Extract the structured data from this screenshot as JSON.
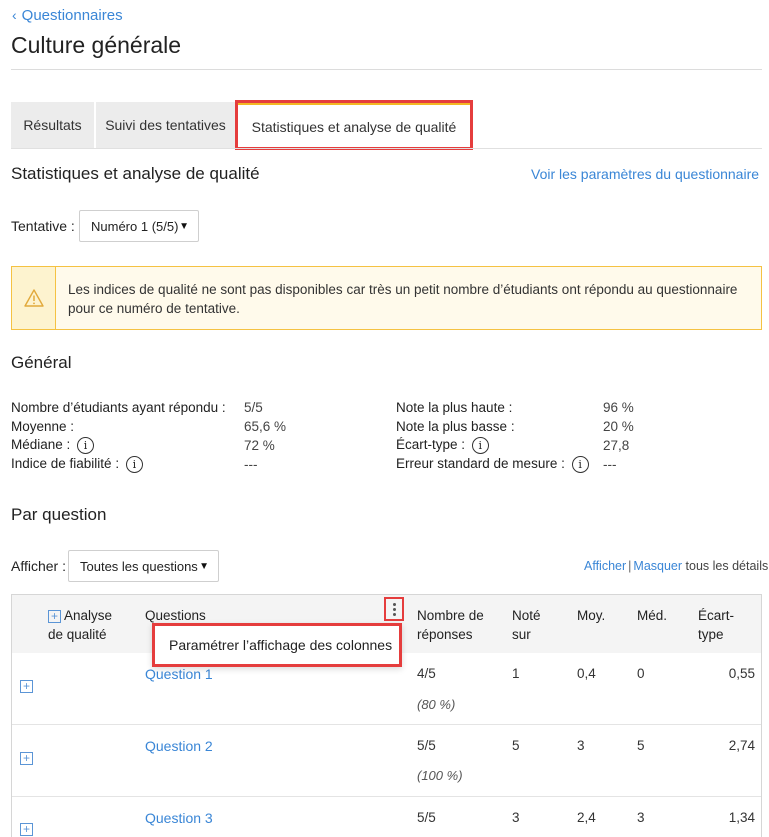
{
  "nav": {
    "back_label": "Questionnaires"
  },
  "page": {
    "title": "Culture générale"
  },
  "tabs": [
    {
      "label": "Résultats"
    },
    {
      "label": "Suivi des tentatives"
    },
    {
      "label": "Statistiques et analyse de qualité",
      "active": true
    }
  ],
  "section": {
    "title": "Statistiques et analyse de qualité",
    "settings_link": "Voir les paramètres du questionnaire"
  },
  "attempt": {
    "label": "Tentative :",
    "selected": "Numéro 1 (5/5)"
  },
  "alert": {
    "icon": "warning-icon",
    "text": "Les indices de qualité ne sont pas disponibles car très un petit nombre d’étudiants ont répondu au questionnaire pour ce numéro de tentative."
  },
  "general": {
    "title": "Général",
    "left": [
      {
        "label": "Nombre d’étudiants ayant répondu :",
        "value": "5/5"
      },
      {
        "label": "Moyenne :",
        "value": "65,6 %"
      },
      {
        "label": "Médiane :",
        "value": "72 %",
        "info": true
      },
      {
        "label": "Indice de fiabilité :",
        "value": "---",
        "info": true
      }
    ],
    "right": [
      {
        "label": "Note la plus haute :",
        "value": "96 %"
      },
      {
        "label": "Note la plus basse :",
        "value": "20 %"
      },
      {
        "label": "Écart-type :",
        "value": "27,8",
        "info": true
      },
      {
        "label": "Erreur standard de mesure :",
        "value": "---",
        "info": true
      }
    ]
  },
  "per_question": {
    "title": "Par question",
    "show_label": "Afficher :",
    "show_selected": "Toutes les questions",
    "details_show": "Afficher",
    "details_hide": "Masquer",
    "details_suffix": "tous les détails",
    "columns": {
      "quality_line1": "Analyse",
      "quality_line2": "de qualité",
      "questions": "Questions",
      "responses_line1": "Nombre de",
      "responses_line2": "réponses",
      "scored_line1": "Noté",
      "scored_line2": "sur",
      "mean": "Moy.",
      "median": "Méd.",
      "sd_line1": "Écart-",
      "sd_line2": "type"
    },
    "column_menu_item": "Paramétrer l’affichage des colonnes",
    "rows": [
      {
        "question": "Question 1",
        "responses": "4/5",
        "responses_pct": "(80 %)",
        "scored": "1",
        "mean": "0,4",
        "median": "0",
        "sd": "0,55"
      },
      {
        "question": "Question 2",
        "responses": "5/5",
        "responses_pct": "(100 %)",
        "scored": "5",
        "mean": "3",
        "median": "5",
        "sd": "2,74"
      },
      {
        "question": "Question 3",
        "responses": "5/5",
        "responses_pct": "",
        "scored": "3",
        "mean": "2,4",
        "median": "3",
        "sd": "1,34"
      }
    ]
  }
}
